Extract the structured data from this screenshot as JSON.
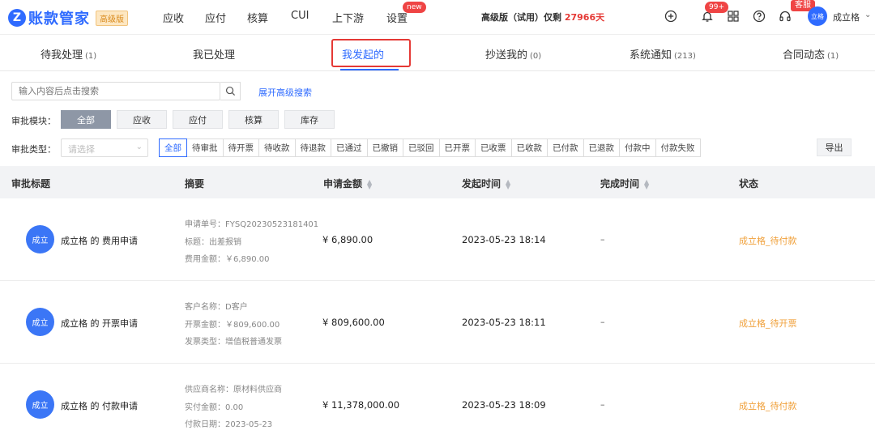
{
  "app": {
    "logo_letter": "Z",
    "name": "账款管家",
    "edition_badge": "高级版"
  },
  "nav": {
    "items": [
      "应收",
      "应付",
      "核算",
      "CUI",
      "上下游",
      "设置"
    ],
    "new_badge": "new",
    "trial_text": "高级版（试用）仅剩",
    "trial_number": "27966天",
    "notification_count": "99+",
    "service_badge": "客服",
    "avatar_text": "立格",
    "username": "成立格"
  },
  "tabs": [
    {
      "label": "待我处理",
      "count": "(1)"
    },
    {
      "label": "我已处理",
      "count": ""
    },
    {
      "label": "我发起的",
      "count": ""
    },
    {
      "label": "抄送我的",
      "count": "(0)"
    },
    {
      "label": "系统通知",
      "count": "(213)"
    },
    {
      "label": "合同动态",
      "count": "(1)"
    }
  ],
  "filters": {
    "search_placeholder": "输入内容后点击搜索",
    "advanced_search": "展开高级搜索",
    "module_label": "审批模块：",
    "modules": [
      "全部",
      "应收",
      "应付",
      "核算",
      "库存"
    ],
    "type_label": "审批类型：",
    "type_placeholder": "请选择",
    "types": [
      "全部",
      "待审批",
      "待开票",
      "待收款",
      "待退款",
      "已通过",
      "已撤销",
      "已驳回",
      "已开票",
      "已收票",
      "已收款",
      "已付款",
      "已退款",
      "付款中",
      "付款失败"
    ],
    "export": "导出"
  },
  "table": {
    "columns": [
      "审批标题",
      "摘要",
      "申请金额",
      "发起时间",
      "完成时间",
      "状态"
    ],
    "rows": [
      {
        "avatar": "成立",
        "title": "成立格 的 费用申请",
        "summary": [
          "申请单号：FYSQ20230523181401",
          "标题：出差报销",
          "费用金额：￥6,890.00"
        ],
        "amount": "¥ 6,890.00",
        "start_time": "2023-05-23 18:14",
        "finish_time": "–",
        "status": "成立格_待付款"
      },
      {
        "avatar": "成立",
        "title": "成立格 的 开票申请",
        "summary": [
          "客户名称：D客户",
          "开票金额：￥809,600.00",
          "发票类型：增值税普通发票"
        ],
        "amount": "¥ 809,600.00",
        "start_time": "2023-05-23 18:11",
        "finish_time": "–",
        "status": "成立格_待开票"
      },
      {
        "avatar": "成立",
        "title": "成立格 的 付款申请",
        "summary": [
          "供应商名称：原材料供应商",
          "实付金额：0.00",
          "付款日期：2023-05-23"
        ],
        "amount": "¥ 11,378,000.00",
        "start_time": "2023-05-23 18:09",
        "finish_time": "–",
        "status": "成立格_待付款"
      }
    ]
  },
  "colors": {
    "brand": "#2f6bff",
    "status_pending": "#f0a03a",
    "highlight": "#e53935"
  }
}
